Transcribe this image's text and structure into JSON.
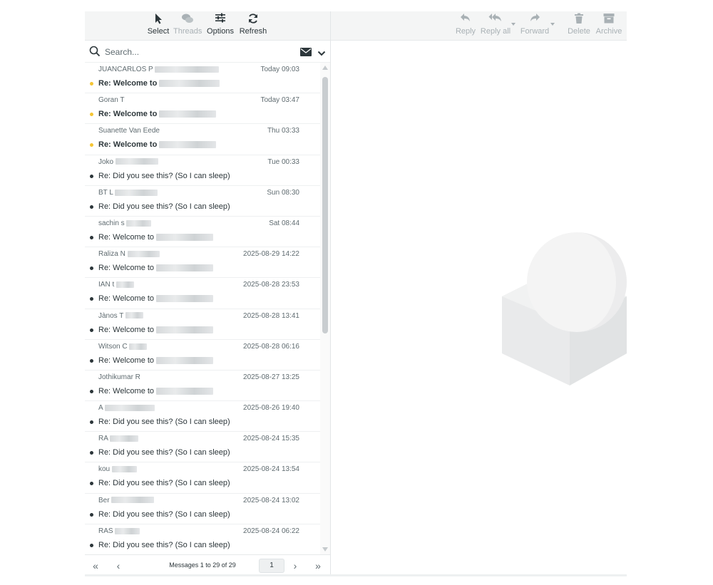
{
  "toolbar_left": {
    "select": "Select",
    "threads": "Threads",
    "options": "Options",
    "refresh": "Refresh"
  },
  "search": {
    "placeholder": "Search..."
  },
  "messages": [
    {
      "from": "JUANCARLOS P",
      "date": "Today 09:03",
      "subject": "Re: Welcome to",
      "unread": true
    },
    {
      "from": "Goran T",
      "date": "Today 03:47",
      "subject": "Re: Welcome to",
      "unread": true
    },
    {
      "from": "Suanette Van Eede",
      "date": "Thu 03:33",
      "subject": "Re: Welcome to",
      "unread": true
    },
    {
      "from": "Joko",
      "date": "Tue 00:33",
      "subject": "Re: Did you see this? (So I can sleep)",
      "unread": false
    },
    {
      "from": "BT L",
      "date": "Sun 08:30",
      "subject": "Re: Did you see this? (So I can sleep)",
      "unread": false
    },
    {
      "from": "sachin s",
      "date": "Sat 08:44",
      "subject": "Re: Welcome to",
      "unread": false
    },
    {
      "from": "Raliza N",
      "date": "2025-08-29 14:22",
      "subject": "Re: Welcome to",
      "unread": false
    },
    {
      "from": "IAN t",
      "date": "2025-08-28 23:53",
      "subject": "Re: Welcome to",
      "unread": false
    },
    {
      "from": "Jànos T",
      "date": "2025-08-28 13:41",
      "subject": "Re: Welcome to",
      "unread": false
    },
    {
      "from": "Witson C",
      "date": "2025-08-28 06:16",
      "subject": "Re: Welcome to",
      "unread": false
    },
    {
      "from": "Jothikumar R",
      "date": "2025-08-27 13:25",
      "subject": "Re: Welcome to",
      "unread": false
    },
    {
      "from": "A",
      "date": "2025-08-26 19:40",
      "subject": "Re: Did you see this? (So I can sleep)",
      "unread": false
    },
    {
      "from": "RA",
      "date": "2025-08-24 15:35",
      "subject": "Re: Did you see this? (So I can sleep)",
      "unread": false
    },
    {
      "from": "kou",
      "date": "2025-08-24 13:54",
      "subject": "Re: Did you see this? (So I can sleep)",
      "unread": false
    },
    {
      "from": "Ber",
      "date": "2025-08-24 13:02",
      "subject": "Re: Did you see this? (So I can sleep)",
      "unread": false
    },
    {
      "from": "RAS",
      "date": "2025-08-24 06:22",
      "subject": "Re: Did you see this? (So I can sleep)",
      "unread": false
    }
  ],
  "footer": {
    "count": "Messages 1 to 29 of 29",
    "page": "1"
  },
  "toolbar_right": {
    "reply": "Reply",
    "reply_all": "Reply all",
    "forward": "Forward",
    "delete": "Delete",
    "archive": "Archive"
  },
  "colors": {
    "unread_dot": "#f5c534",
    "read_dot": "#2c363a",
    "toolbar_bg": "#f4f5f5",
    "disabled_text": "#a9b1b5"
  }
}
